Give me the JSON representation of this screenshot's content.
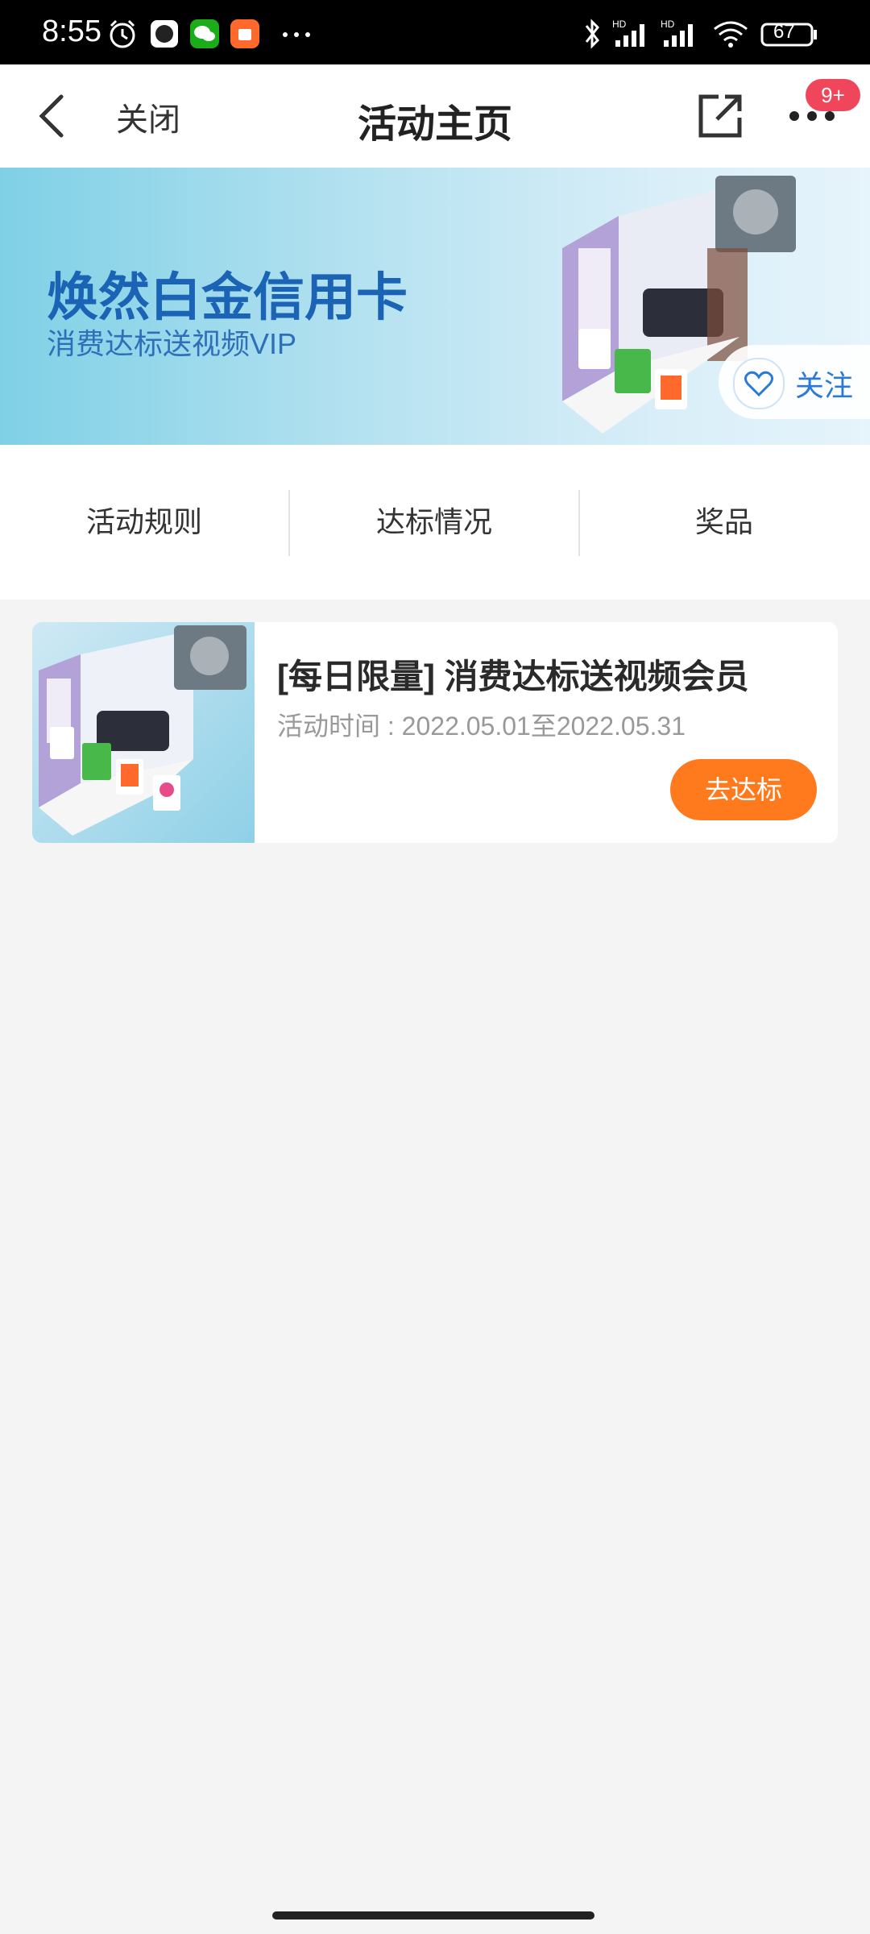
{
  "status_bar": {
    "time": "8:55",
    "battery": "67",
    "icons": [
      "alarm-icon",
      "app-icon",
      "wechat-icon",
      "shop-icon",
      "more-dots-icon",
      "bluetooth-icon",
      "signal-hd-icon",
      "signal-hd-icon",
      "wifi-icon",
      "battery-icon"
    ],
    "network_label": "HD"
  },
  "header": {
    "close_label": "关闭",
    "title": "活动主页",
    "badge": "9+"
  },
  "banner": {
    "title": "焕然白金信用卡",
    "subtitle": "消费达标送视频VIP",
    "follow_label": "关注"
  },
  "tabs": [
    {
      "label": "活动规则"
    },
    {
      "label": "达标情况"
    },
    {
      "label": "奖品"
    }
  ],
  "activity_card": {
    "title": "[每日限量] 消费达标送视频会员",
    "time_text": "活动时间 : 2022.05.01至2022.05.31",
    "button_label": "去达标"
  },
  "colors": {
    "accent_orange": "#ff7a1d",
    "banner_blue": "#1a63b5",
    "badge_red": "#f0465b",
    "follow_blue": "#2b7bd6"
  }
}
